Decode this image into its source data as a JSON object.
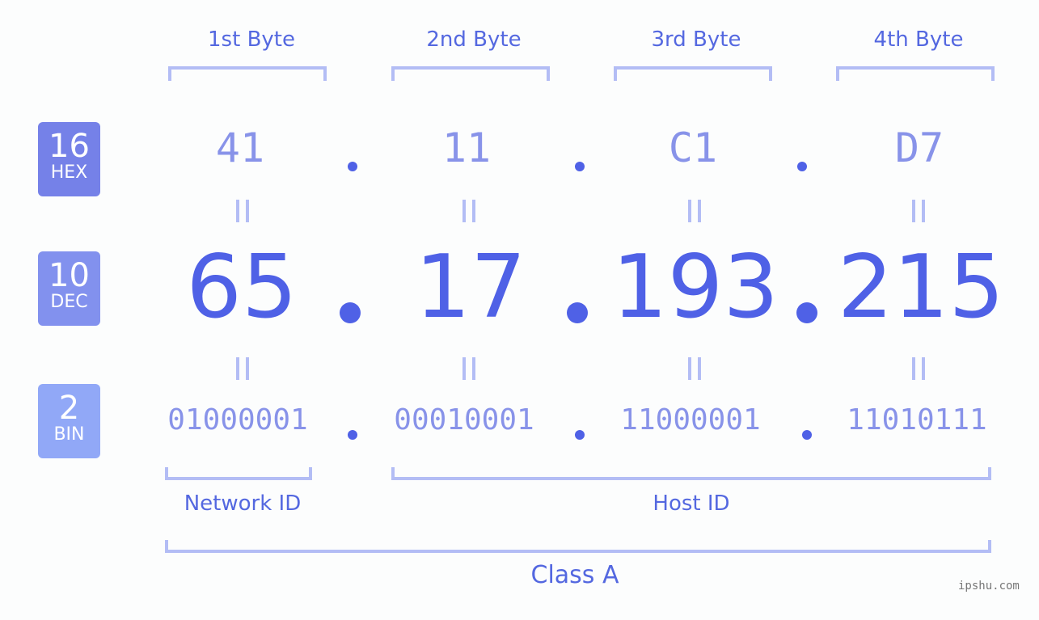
{
  "header": {
    "bytes": [
      "1st Byte",
      "2nd Byte",
      "3rd Byte",
      "4th Byte"
    ]
  },
  "badges": {
    "hex": {
      "num": "16",
      "label": "HEX",
      "color": "#7581e8"
    },
    "dec": {
      "num": "10",
      "label": "DEC",
      "color": "#8291ee"
    },
    "bin": {
      "num": "2",
      "label": "BIN",
      "color": "#91a8f7"
    }
  },
  "ip": {
    "hex": [
      "41",
      "11",
      "C1",
      "D7"
    ],
    "dec": [
      "65",
      "17",
      "193",
      "215"
    ],
    "bin": [
      "01000001",
      "00010001",
      "11000001",
      "11010111"
    ]
  },
  "segments": {
    "network": "Network ID",
    "host": "Host ID",
    "class": "Class A"
  },
  "watermark": "ipshu.com"
}
